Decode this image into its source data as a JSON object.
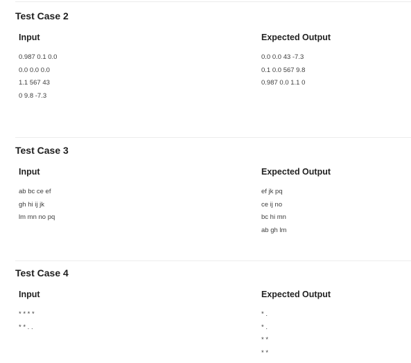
{
  "test_cases": [
    {
      "title": "Test Case 2",
      "input_label": "Input",
      "output_label": "Expected Output",
      "input_lines": [
        "0.987 0.1 0.0",
        "0.0 0.0 0.0",
        "1.1 567 43",
        "0 9.8 -7.3"
      ],
      "output_lines": [
        "0.0 0.0 43 -7.3",
        "0.1 0.0 567 9.8",
        "0.987 0.0 1.1 0"
      ]
    },
    {
      "title": "Test Case 3",
      "input_label": "Input",
      "output_label": "Expected Output",
      "input_lines": [
        "ab bc ce ef",
        "gh hi ij jk",
        "lm mn no pq"
      ],
      "output_lines": [
        "ef jk pq",
        "ce ij no",
        "bc hi mn",
        "ab gh lm"
      ]
    },
    {
      "title": "Test Case 4",
      "input_label": "Input",
      "output_label": "Expected Output",
      "input_lines": [
        "* * * *",
        "* * . ."
      ],
      "output_lines": [
        "* .",
        "* .",
        "* *",
        "* *"
      ]
    }
  ]
}
